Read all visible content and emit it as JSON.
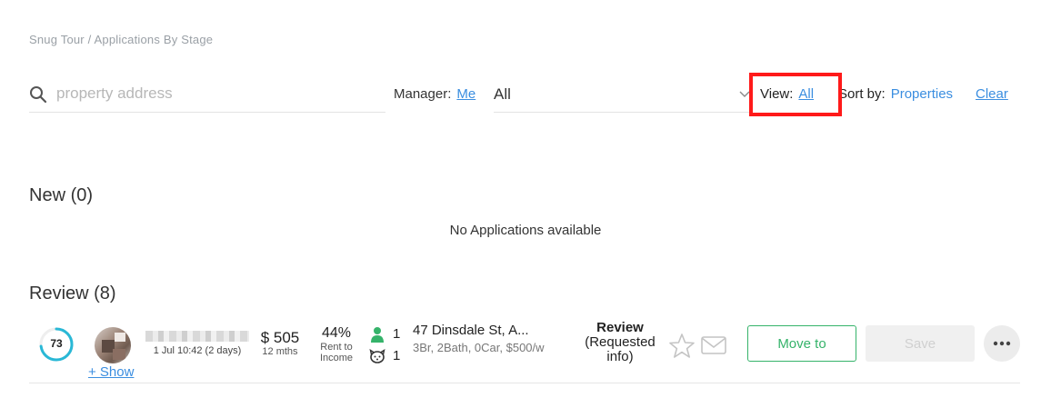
{
  "breadcrumb": "Snug Tour / Applications By Stage",
  "search": {
    "placeholder": "property address"
  },
  "manager": {
    "label": "Manager:",
    "me_link": "Me",
    "selected": "All"
  },
  "view": {
    "label": "View:",
    "value": "All"
  },
  "sort": {
    "label": "Sort by:",
    "value": "Properties",
    "clear": "Clear"
  },
  "sections": {
    "new": {
      "title": "New (0)",
      "empty_message": "No Applications available"
    },
    "review": {
      "title": "Review (8)"
    }
  },
  "application": {
    "score": "73",
    "score_fraction": 0.73,
    "date": "1 Jul 10:42 (2 days)",
    "show_link": "+ Show",
    "rent_amount": "$ 505",
    "rent_term": "12 mths",
    "rent_to_income_pct": "44%",
    "rent_to_income_label1": "Rent to",
    "rent_to_income_label2": "Income",
    "adults": "1",
    "pets": "1",
    "address": "47 Dinsdale St, A...",
    "details": "3Br, 2Bath, 0Car, $500/w",
    "status_line1": "Review",
    "status_line2": "(Requested",
    "status_line3": "info)",
    "move_to_label": "Move to",
    "save_label": "Save"
  },
  "colors": {
    "accent_blue": "#3b8ee0",
    "success_green": "#35b36a",
    "score_ring": "#29b8d6",
    "highlight_red": "#ff1a1a"
  }
}
